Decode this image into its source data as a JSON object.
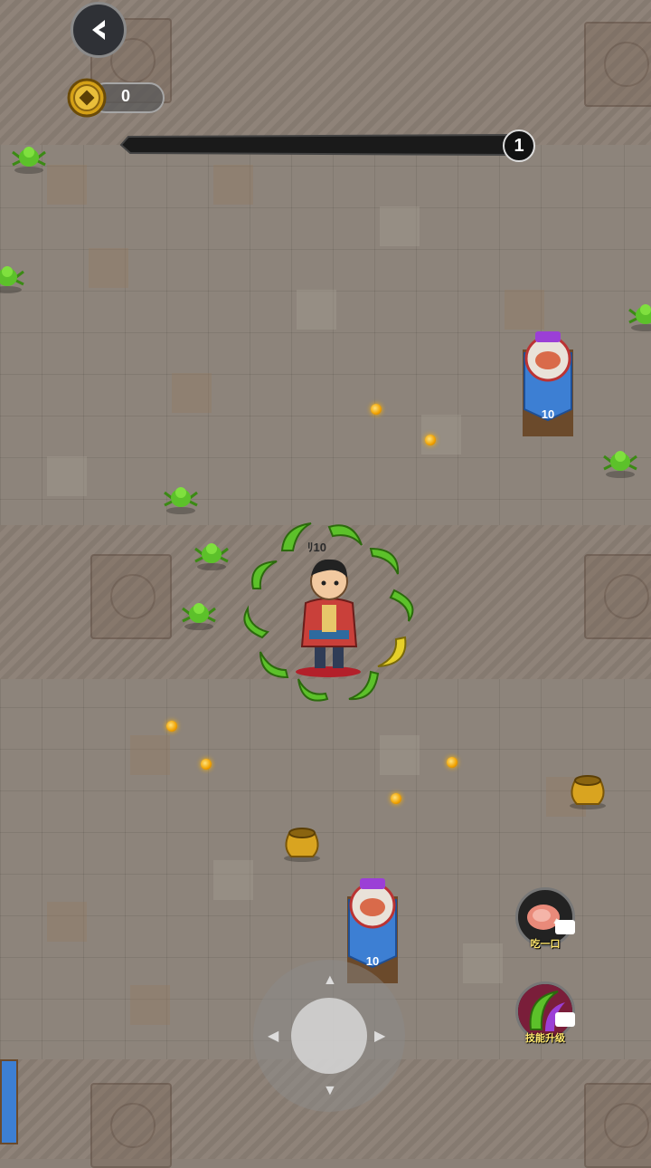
{
  "hud": {
    "back_icon": "chevron-left-icon",
    "coin_icon": "copper-coin-icon",
    "coin_count": "0",
    "xp_level": "1"
  },
  "banners": [
    {
      "label": "10"
    },
    {
      "label": "10"
    }
  ],
  "hero": {
    "tag": "ﾘ10"
  },
  "skills": [
    {
      "icon": "meat-icon",
      "label": "吃一口"
    },
    {
      "icon": "boomerang-icon",
      "label": "技能升级"
    }
  ],
  "joystick": {
    "icon": "joystick-icon"
  },
  "colors": {
    "accent_green": "#5cc12a",
    "banner_blue": "#3d7fd3",
    "coin_gold": "#d4a017"
  }
}
